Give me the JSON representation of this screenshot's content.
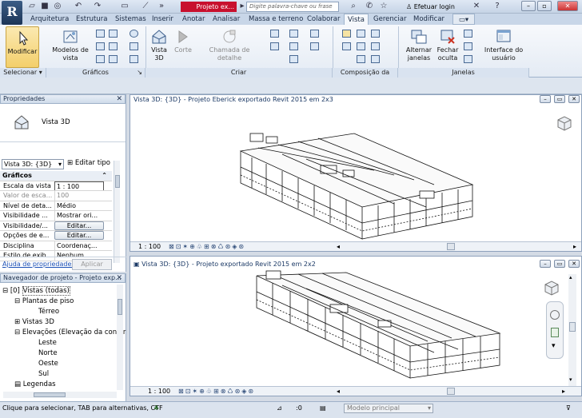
{
  "titlebar": {
    "logo": "R",
    "doc_title": "Projeto ex...",
    "search_placeholder": "Digite palavra-chave ou frase",
    "login_label": "Efetuar login",
    "help_icon": "question-icon"
  },
  "tabs": [
    "Arquitetura",
    "Estrutura",
    "Sistemas",
    "Inserir",
    "Anotar",
    "Analisar",
    "Massa e terreno",
    "Colaborar",
    "Vista",
    "Gerenciar",
    "Modificar"
  ],
  "active_tab": "Vista",
  "ribbon": {
    "modificar": "Modificar",
    "modelos_de_vista": "Modelos de vista",
    "vista_3d": "Vista 3D",
    "corte": "Corte",
    "chamada": "Chamada de detalhe",
    "alternar_janelas": "Alternar janelas",
    "fechar_oculta": "Fechar oculta",
    "interface_usuario": "Interface do usuário",
    "groups": {
      "selecionar": "Selecionar",
      "graficos": "Gráficos",
      "criar": "Criar",
      "composicao": "Composição da folha",
      "janelas": "Janelas"
    }
  },
  "properties": {
    "title": "Propriedades",
    "type_name": "Vista 3D",
    "instance_selector": "Vista 3D: {3D}",
    "edit_type": "Editar tipo",
    "section": "Gráficos",
    "rows": [
      {
        "key": "Escala da vista",
        "value": "1 : 100"
      },
      {
        "key": "Valor de esca...",
        "value": "100"
      },
      {
        "key": "Nível de deta...",
        "value": "Médio"
      },
      {
        "key": "Visibilidade ...",
        "value": "Mostrar ori..."
      },
      {
        "key": "Visibilidade/...",
        "value": "Editar..."
      },
      {
        "key": "Opções de e...",
        "value": "Editar..."
      },
      {
        "key": "Disciplina",
        "value": "Coordenaç..."
      },
      {
        "key": "Estilo de exib...",
        "value": "Nenhum"
      }
    ],
    "help_link": "Ajuda de propriedades",
    "apply": "Aplicar"
  },
  "browser": {
    "title": "Navegador de projeto - Projeto exp...",
    "items": [
      "Vistas (todas)",
      "Plantas de piso",
      "Térreo",
      "Vistas 3D",
      "Elevações (Elevação da constr",
      "Leste",
      "Norte",
      "Oeste",
      "Sul",
      "Legendas"
    ]
  },
  "views": {
    "top_title": "Vista 3D: {3D} - Projeto Eberick exportado Revit 2015 em 2x3",
    "bottom_title": "Vista 3D: {3D} - Projeto exportado Revit 2015 em 2x2",
    "scale": "1 : 100"
  },
  "status": {
    "hint": "Clique para selecionar, TAB para alternativas, CTF",
    "zero": ":0",
    "model": "Modelo principal"
  }
}
